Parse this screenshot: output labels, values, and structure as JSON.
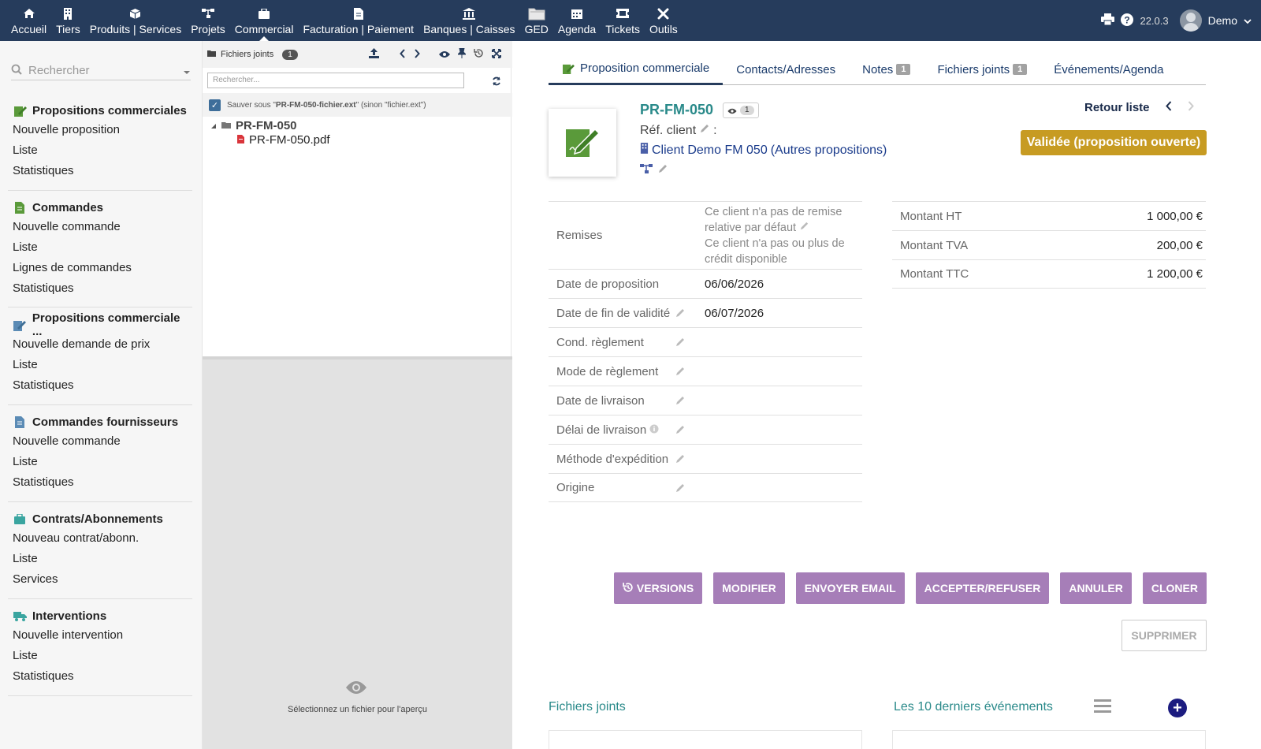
{
  "topmenu": {
    "items": [
      {
        "label": "Accueil",
        "icon": "home-icon"
      },
      {
        "label": "Tiers",
        "icon": "building-icon"
      },
      {
        "label": "Produits | Services",
        "icon": "cube-icon"
      },
      {
        "label": "Projets",
        "icon": "sitemap-icon"
      },
      {
        "label": "Commercial",
        "icon": "suitcase-icon"
      },
      {
        "label": "Facturation | Paiement",
        "icon": "invoice-icon"
      },
      {
        "label": "Banques | Caisses",
        "icon": "bank-icon"
      },
      {
        "label": "GED",
        "icon": "folder-icon"
      },
      {
        "label": "Agenda",
        "icon": "calendar-icon"
      },
      {
        "label": "Tickets",
        "icon": "ticket-icon"
      },
      {
        "label": "Outils",
        "icon": "tools-icon"
      }
    ],
    "version": "22.0.3",
    "username": "Demo"
  },
  "sidebar": {
    "search_placeholder": "Rechercher",
    "blocks": [
      {
        "title": "Propositions commerciales",
        "items": [
          "Nouvelle proposition",
          "Liste",
          "Statistiques"
        ]
      },
      {
        "title": "Commandes",
        "items": [
          "Nouvelle commande",
          "Liste",
          "Lignes de commandes",
          "Statistiques"
        ]
      },
      {
        "title": "Propositions commerciale ...",
        "items": [
          "Nouvelle demande de prix",
          "Liste",
          "Statistiques"
        ]
      },
      {
        "title": "Commandes fournisseurs",
        "items": [
          "Nouvelle commande",
          "Liste",
          "Statistiques"
        ]
      },
      {
        "title": "Contrats/Abonnements",
        "items": [
          "Nouveau contrat/abonn.",
          "Liste",
          "Services"
        ]
      },
      {
        "title": "Interventions",
        "items": [
          "Nouvelle intervention",
          "Liste",
          "Statistiques"
        ]
      }
    ]
  },
  "filemanager": {
    "title": "Fichiers joints",
    "count": "1",
    "search_placeholder": "Rechercher...",
    "save_prefix": "Sauver sous \"",
    "save_name": "PR-FM-050-fichier.ext",
    "save_suffix": "\" (sinon \"fichier.ext\")",
    "tree_folder": "PR-FM-050",
    "tree_file": "PR-FM-050.pdf",
    "preview_text": "Sélectionnez un fichier pour l'aperçu"
  },
  "tabs": [
    {
      "label": "Proposition commerciale",
      "badge": ""
    },
    {
      "label": "Contacts/Adresses",
      "badge": ""
    },
    {
      "label": "Notes",
      "badge": "1"
    },
    {
      "label": "Fichiers joints",
      "badge": "1"
    },
    {
      "label": "Événements/Agenda",
      "badge": ""
    }
  ],
  "object": {
    "ref": "PR-FM-050",
    "views": "1",
    "ref_client_label": "Réf. client",
    "ref_client_colon": ":",
    "client_name": "Client Demo FM 050",
    "client_other": "(Autres propositions)",
    "back_label": "Retour liste",
    "status": "Validée (proposition ouverte)"
  },
  "fields": [
    {
      "label": "Remises",
      "value_lines": [
        "Ce client n'a pas de remise relative par défaut",
        "Ce client n'a pas ou plus de crédit disponible"
      ]
    },
    {
      "label": "Date de proposition",
      "value": "06/06/2026"
    },
    {
      "label": "Date de fin de validité",
      "value": "06/07/2026"
    },
    {
      "label": "Cond. règlement",
      "value": ""
    },
    {
      "label": "Mode de règlement",
      "value": ""
    },
    {
      "label": "Date de livraison",
      "value": ""
    },
    {
      "label": "Délai de livraison",
      "value": ""
    },
    {
      "label": "Méthode d'expédition",
      "value": ""
    },
    {
      "label": "Origine",
      "value": ""
    }
  ],
  "amounts": [
    {
      "label": "Montant HT",
      "value": "1 000,00 €"
    },
    {
      "label": "Montant TVA",
      "value": "200,00 €"
    },
    {
      "label": "Montant TTC",
      "value": "1 200,00 €"
    }
  ],
  "actions": [
    "VERSIONS",
    "MODIFIER",
    "ENVOYER EMAIL",
    "ACCEPTER/REFUSER",
    "ANNULER",
    "CLONER"
  ],
  "delete_label": "SUPPRIMER",
  "sections": {
    "files_title": "Fichiers joints",
    "events_title": "Les 10 derniers événements"
  },
  "colors": {
    "topbar": "#263c5c",
    "status": "#c79b22",
    "action_button": "#a67eb8",
    "accent_teal": "#2a8a8a"
  }
}
